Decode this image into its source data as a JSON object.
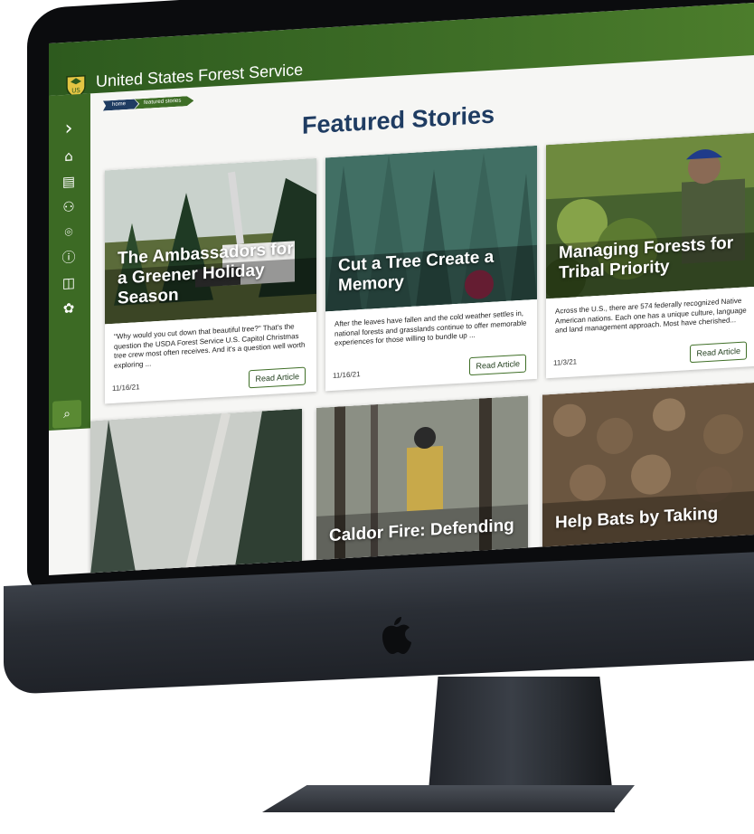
{
  "header": {
    "agency_prefix": "United States ",
    "agency_name": "Forest Service"
  },
  "breadcrumb": {
    "home": "home",
    "current": "featured stories"
  },
  "page": {
    "title": "Featured Stories"
  },
  "sidebar": {
    "items": [
      {
        "icon": "chevron-right-icon",
        "glyph": "›"
      },
      {
        "icon": "home-icon",
        "glyph": "⌂"
      },
      {
        "icon": "news-icon",
        "glyph": "▤"
      },
      {
        "icon": "people-icon",
        "glyph": "⚇"
      },
      {
        "icon": "location-icon",
        "glyph": "⌾"
      },
      {
        "icon": "info-icon",
        "glyph": "ⓘ"
      },
      {
        "icon": "book-icon",
        "glyph": "◫"
      },
      {
        "icon": "handshake-icon",
        "glyph": "✿"
      }
    ],
    "search_glyph": "⌕"
  },
  "cards": [
    {
      "title": "The Ambassadors for a Greener Holiday Season",
      "desc": "\"Why would you cut down that beautiful tree?\" That's the question the USDA Forest Service U.S. Capitol Christmas tree crew most often receives. And it's a question well worth exploring ...",
      "date": "11/16/21",
      "button": "Read Article"
    },
    {
      "title": "Cut a Tree Create a Memory",
      "desc": "After the leaves have fallen and the cold weather settles in, national forests and grasslands continue to offer memorable experiences for those willing to bundle up ...",
      "date": "11/16/21",
      "button": "Read Article"
    },
    {
      "title": "Managing Forests for Tribal Priority",
      "desc": "Across the U.S., there are 574 federally recognized Native American nations. Each one has a unique culture, language and land management approach. Most have cherished...",
      "date": "11/3/21",
      "button": "Read Article"
    },
    {
      "title": ""
    },
    {
      "title": "Caldor Fire: Defending"
    },
    {
      "title": "Help Bats by Taking"
    }
  ],
  "colors": {
    "forest_green": "#3c6a24",
    "navy": "#1f3c62",
    "bezel": "#0d0e10"
  }
}
